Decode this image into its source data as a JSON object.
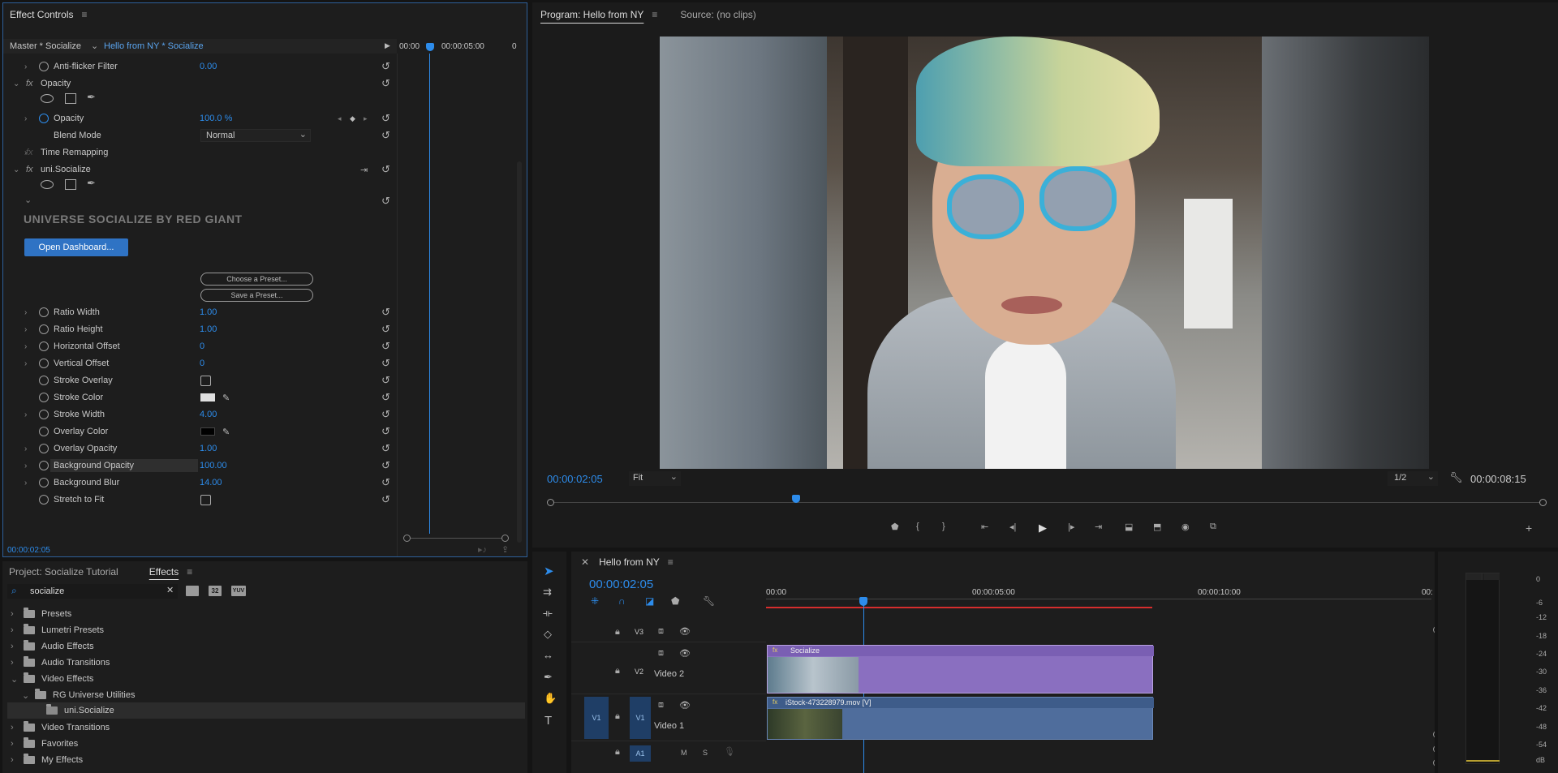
{
  "effect_controls": {
    "tab": "Effect Controls",
    "master_label": "Master * Socialize",
    "clip_label": "Hello from NY * Socialize",
    "timecodes": [
      "00:00",
      "00:00:05:00",
      "0"
    ],
    "current_time": "00:00:02:05",
    "rows": {
      "anti_flicker": {
        "label": "Anti-flicker Filter",
        "value": "0.00"
      },
      "opacity_group": "Opacity",
      "opacity": {
        "label": "Opacity",
        "value": "100.0 %"
      },
      "blend_mode": {
        "label": "Blend Mode",
        "value": "Normal"
      },
      "time_remap": "Time Remapping",
      "socialize_group": "uni.Socialize",
      "brand": "UNIVERSE SOCIALIZE BY RED GIANT",
      "open_dashboard": "Open Dashboard...",
      "choose_preset": "Choose a Preset...",
      "save_preset": "Save a Preset...",
      "ratio_width": {
        "label": "Ratio Width",
        "value": "1.00"
      },
      "ratio_height": {
        "label": "Ratio Height",
        "value": "1.00"
      },
      "h_offset": {
        "label": "Horizontal Offset",
        "value": "0"
      },
      "v_offset": {
        "label": "Vertical Offset",
        "value": "0"
      },
      "stroke_overlay": {
        "label": "Stroke Overlay"
      },
      "stroke_color": {
        "label": "Stroke Color",
        "color": "#e0e0e0"
      },
      "stroke_width": {
        "label": "Stroke Width",
        "value": "4.00"
      },
      "overlay_color": {
        "label": "Overlay Color",
        "color": "#000000"
      },
      "overlay_opacity": {
        "label": "Overlay Opacity",
        "value": "1.00"
      },
      "bg_opacity": {
        "label": "Background Opacity",
        "value": "100.00"
      },
      "bg_blur": {
        "label": "Background Blur",
        "value": "14.00"
      },
      "stretch": {
        "label": "Stretch to Fit"
      }
    }
  },
  "project_panel": {
    "tab_project": "Project: Socialize Tutorial",
    "tab_effects": "Effects",
    "search_value": "socialize",
    "badges": [
      "",
      "32",
      "YUV"
    ],
    "items": [
      {
        "label": "Presets"
      },
      {
        "label": "Lumetri Presets"
      },
      {
        "label": "Audio Effects"
      },
      {
        "label": "Audio Transitions"
      },
      {
        "label": "Video Effects"
      },
      {
        "label": "RG Universe Utilities"
      },
      {
        "label": "uni.Socialize"
      },
      {
        "label": "Video Transitions"
      },
      {
        "label": "Favorites"
      },
      {
        "label": "My Effects"
      }
    ]
  },
  "program_monitor": {
    "tab_program": "Program: Hello from NY",
    "tab_source": "Source: (no clips)",
    "timecode": "00:00:02:05",
    "fit": "Fit",
    "resolution": "1/2",
    "duration": "00:00:08:15"
  },
  "timeline": {
    "tab": "Hello from NY",
    "timecode": "00:00:02:05",
    "ruler": [
      "00:00",
      "00:00:05:00",
      "00:00:10:00",
      "00:"
    ],
    "tracks": {
      "v3": "V3",
      "v2": "V2",
      "v2_name": "Video 2",
      "v1": "V1",
      "v1_src": "V1",
      "v1_name": "Video 1",
      "a1": "A1",
      "m": "M",
      "s": "S"
    },
    "clips": {
      "socialize": "Socialize",
      "video": "iStock-473228979.mov [V]"
    }
  },
  "audio_meter": {
    "labels": [
      "0",
      "-6",
      "-12",
      "-18",
      "-24",
      "-30",
      "-36",
      "-42",
      "-48",
      "-54",
      "dB"
    ]
  },
  "colors": {
    "accent": "#2d8ceb",
    "clip_purple": "#8a6fc0",
    "clip_blue": "#4f6d9c",
    "red_bar": "#d62d2d"
  }
}
